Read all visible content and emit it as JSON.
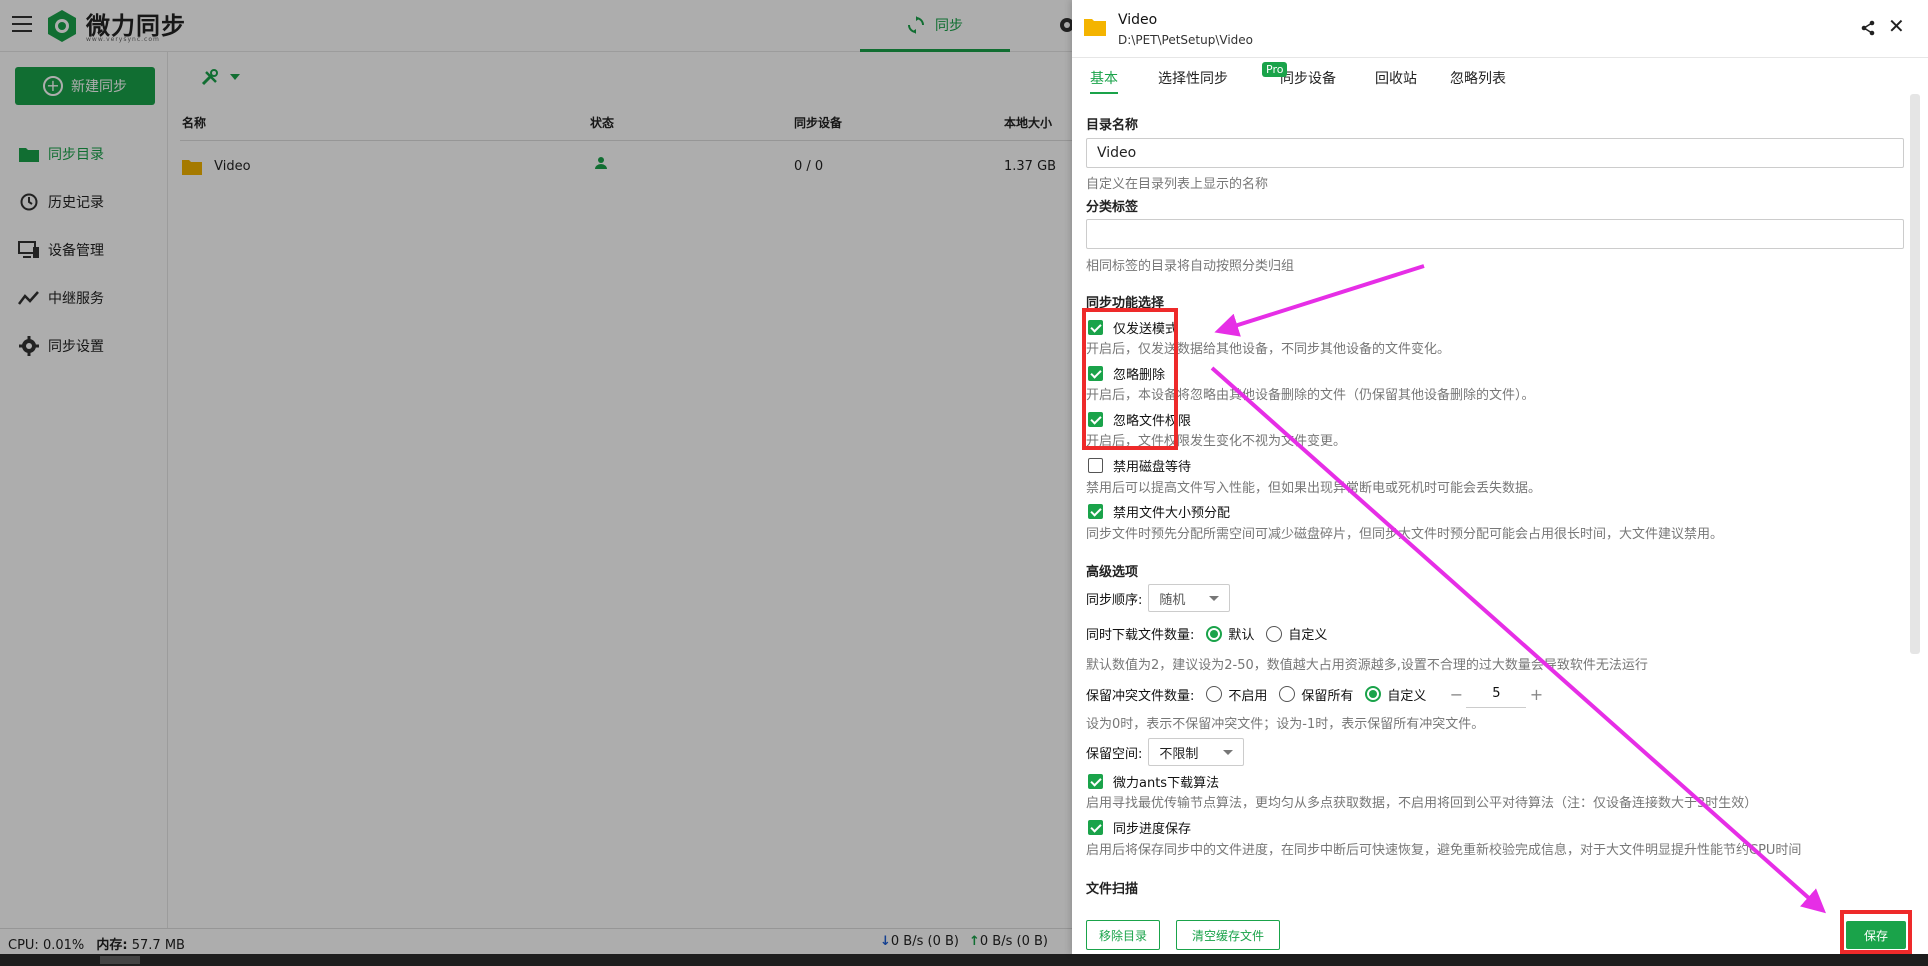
{
  "app": {
    "brand": "微力同步",
    "brand_sub": "www.verysync.com",
    "top_tab": "同步",
    "new_sync_label": "新建同步",
    "nav": [
      {
        "label": "同步目录",
        "icon": "folder-icon",
        "active": true
      },
      {
        "label": "历史记录",
        "icon": "history-icon",
        "active": false
      },
      {
        "label": "设备管理",
        "icon": "device-icon",
        "active": false
      },
      {
        "label": "中继服务",
        "icon": "relay-icon",
        "active": false
      },
      {
        "label": "同步设置",
        "icon": "gear-icon",
        "active": false
      }
    ],
    "table": {
      "headers": [
        "名称",
        "状态",
        "同步设备",
        "本地大小"
      ],
      "rows": [
        {
          "name": "Video",
          "devices": "0 / 0",
          "size": "1.37 GB"
        }
      ]
    },
    "status": {
      "cpu_label": "CPU:",
      "cpu": "0.01%",
      "mem_label": "内存:",
      "mem": "57.7 MB",
      "down": "0 B/s (0 B)",
      "up": "0 B/s (0 B)"
    }
  },
  "drawer": {
    "title": "Video",
    "path": "D:\\PET\\PetSetup\\Video",
    "tabs": [
      "基本",
      "选择性同步",
      "同步设备",
      "回收站",
      "忽略列表"
    ],
    "pro_badge": "Pro",
    "dir_name_label": "目录名称",
    "dir_name_value": "Video",
    "dir_name_hint": "自定义在目录列表上显示的名称",
    "tag_label": "分类标签",
    "tag_value": "",
    "tag_hint": "相同标签的目录将自动按照分类归组",
    "sync_func_label": "同步功能选择",
    "options": [
      {
        "label": "仅发送模式",
        "checked": true,
        "hint": "开启后，仅发送数据给其他设备，不同步其他设备的文件变化。"
      },
      {
        "label": "忽略删除",
        "checked": true,
        "hint": "开启后，本设备将忽略由其他设备删除的文件（仍保留其他设备删除的文件）。"
      },
      {
        "label": "忽略文件权限",
        "checked": true,
        "hint": "开启后，文件权限发生变化不视为文件变更。"
      },
      {
        "label": "禁用磁盘等待",
        "checked": false,
        "hint": "禁用后可以提高文件写入性能，但如果出现异常断电或死机时可能会丢失数据。"
      },
      {
        "label": "禁用文件大小预分配",
        "checked": true,
        "hint": "同步文件时预先分配所需空间可减少磁盘碎片，但同步大文件时预分配可能会占用很长时间，大文件建议禁用。"
      }
    ],
    "advanced_label": "高级选项",
    "sync_order_label": "同步顺序:",
    "sync_order_value": "随机",
    "concurrent_label": "同时下载文件数量:",
    "concurrent_options": [
      "默认",
      "自定义"
    ],
    "concurrent_selected": "默认",
    "concurrent_hint": "默认数值为2，建议设为2-50，数值越大占用资源越多,设置不合理的过大数量会导致软件无法运行",
    "conflict_label": "保留冲突文件数量:",
    "conflict_options": [
      "不启用",
      "保留所有",
      "自定义"
    ],
    "conflict_selected": "自定义",
    "conflict_value": "5",
    "conflict_minus": "−",
    "conflict_plus": "+",
    "conflict_hint": "设为0时，表示不保留冲突文件；设为-1时，表示保留所有冲突文件。",
    "reserve_label": "保留空间:",
    "reserve_value": "不限制",
    "algo": {
      "label": "微力ants下载算法",
      "checked": true,
      "hint": "启用寻找最优传输节点算法，更均匀从多点获取数据，不启用将回到公平对待算法（注：仅设备连接数大于3时生效）"
    },
    "progress": {
      "label": "同步进度保存",
      "checked": true,
      "hint": "启用后将保存同步中的文件进度，在同步中断后可快速恢复，避免重新校验完成信息，对于大文件明显提升性能节约CPU时间"
    },
    "scan_label": "文件扫描",
    "remove_btn": "移除目录",
    "clear_cache_btn": "清空缓存文件",
    "save_btn": "保存"
  },
  "colors": {
    "accent": "#1aa34a",
    "annotation_red": "#ee2a2a",
    "annotation_magenta": "#e62ee6"
  }
}
